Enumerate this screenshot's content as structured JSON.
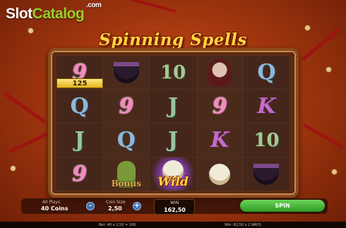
{
  "watermark": {
    "slot": "Slot",
    "catalog": "Catalog",
    "com": ".com"
  },
  "game": {
    "title": "Spinning Spells"
  },
  "reels": {
    "rows": [
      [
        {
          "symbol": "9",
          "kind": "9"
        },
        {
          "symbol": "",
          "kind": "cauldron"
        },
        {
          "symbol": "10",
          "kind": "10"
        },
        {
          "symbol": "",
          "kind": "lady"
        },
        {
          "symbol": "Q",
          "kind": "Q"
        }
      ],
      [
        {
          "symbol": "Q",
          "kind": "Q"
        },
        {
          "symbol": "9",
          "kind": "9"
        },
        {
          "symbol": "J",
          "kind": "J"
        },
        {
          "symbol": "9",
          "kind": "9"
        },
        {
          "symbol": "K",
          "kind": "K"
        }
      ],
      [
        {
          "symbol": "J",
          "kind": "J"
        },
        {
          "symbol": "Q",
          "kind": "Q"
        },
        {
          "symbol": "J",
          "kind": "J"
        },
        {
          "symbol": "K",
          "kind": "K"
        },
        {
          "symbol": "10",
          "kind": "10"
        }
      ],
      [
        {
          "symbol": "9",
          "kind": "9"
        },
        {
          "symbol": "Bonus",
          "kind": "bonus"
        },
        {
          "symbol": "Wild",
          "kind": "wild"
        },
        {
          "symbol": "",
          "kind": "skull"
        },
        {
          "symbol": "",
          "kind": "cauldron"
        }
      ]
    ],
    "win_badge": "125"
  },
  "controls": {
    "all_plays_label": "All Plays",
    "coins_value": "40 Coins",
    "minus": "-",
    "coin_size_label": "Coin Size",
    "coin_size_value": "2,50",
    "plus": "+",
    "win_label": "WIN",
    "win_value": "162,50",
    "spin_label": "SPIN"
  },
  "status": {
    "bet": "Bet: 40 x 2,50 = 100",
    "win": "Win: 62,50 x 2 WAYS"
  },
  "colors": {
    "spin": "#3fae2f",
    "title": "#ffd640",
    "catalog": "#9ad02a"
  }
}
